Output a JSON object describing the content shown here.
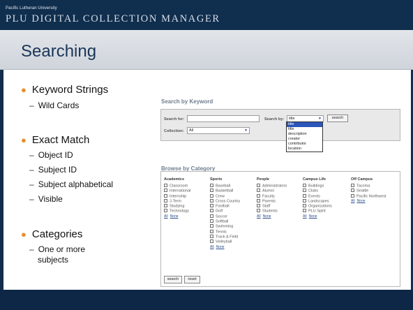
{
  "header": {
    "university": "Pacific Lutheran University",
    "app_title": "PLU DIGITAL COLLECTION MANAGER"
  },
  "slide": {
    "title": "Searching",
    "bullets": [
      {
        "label": "Keyword Strings",
        "subs": [
          "Wild Cards"
        ]
      },
      {
        "label": "Exact Match",
        "subs": [
          "Object ID",
          "Subject ID",
          "Subject alphabetical",
          "Visible"
        ]
      },
      {
        "label": "Categories",
        "subs": [
          "One or more",
          "subjects"
        ]
      }
    ]
  },
  "keyword_search": {
    "heading": "Search by Keyword",
    "search_for_label": "Search for:",
    "search_for_value": "",
    "search_by_label": "Search by:",
    "search_by_value": "title",
    "search_button": "search",
    "collection_label": "Collection:",
    "collection_value": "All",
    "search_by_options": [
      "title",
      "title",
      "description",
      "creator",
      "contributor",
      "location"
    ]
  },
  "browse": {
    "heading": "Browse by Category",
    "all_label": "All",
    "none_label": "None",
    "columns": [
      {
        "title": "Academics",
        "items": [
          "Classroom",
          "International",
          "Internship",
          "J-Term",
          "Studying",
          "Technology"
        ]
      },
      {
        "title": "Sports",
        "items": [
          "Baseball",
          "Basketball",
          "Crew",
          "Cross Country",
          "Football",
          "Golf",
          "Soccer",
          "Softball",
          "Swimming",
          "Tennis",
          "Track & Field",
          "Volleyball"
        ]
      },
      {
        "title": "People",
        "items": [
          "Administrators",
          "Alumni",
          "Faculty",
          "Parents",
          "Staff",
          "Students"
        ]
      },
      {
        "title": "Campus Life",
        "items": [
          "Buildings",
          "Clubs",
          "Events",
          "Landscapes",
          "Organizations",
          "PLU Spirit"
        ]
      },
      {
        "title": "Off Campus",
        "items": [
          "Tacoma",
          "Seattle",
          "Pacific Northwest"
        ]
      }
    ],
    "search_button": "search",
    "reset_button": "reset"
  },
  "colors": {
    "header_bg": "#102e4e",
    "bullet_dot": "#e88d2a",
    "title_color": "#1b3556",
    "dropdown_selected": "#2a55b9"
  }
}
